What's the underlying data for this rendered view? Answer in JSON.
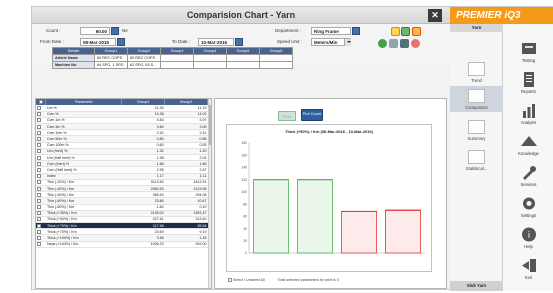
{
  "window": {
    "title": "Comparision Chart - Yarn",
    "close_label": "✕"
  },
  "brand": {
    "name": "PREMIER iQ3",
    "color": "#f39a1b"
  },
  "filters": {
    "count_label": "Count :",
    "count_value": "60.00",
    "count_unit": "Ne",
    "from_date_label": "From Date :",
    "from_date_value": "08-Mar-2016",
    "to_date_label": "To Date :",
    "to_date_value": "10-Mar-2016",
    "department_label": "Department :",
    "department_value": "Ring Frame",
    "speed_unit_label": "Speed Unit :",
    "speed_unit_value": "Meters/Min"
  },
  "summary_table": {
    "headers": [
      "Details",
      "Group1",
      "Group2",
      "Group3",
      "Group4",
      "Group5",
      "Group6"
    ],
    "rows": [
      [
        "Article Name",
        "60 REC COPS",
        "60 REC COPS",
        "",
        "",
        "",
        ""
      ],
      [
        "Machine No",
        "64 SPG, 1 SPG",
        "62 SPG, 63 S...",
        "",
        "",
        "",
        ""
      ]
    ]
  },
  "params": {
    "headers": [
      "",
      "Parameter",
      "Group1",
      "Group2"
    ],
    "rows": [
      [
        "Um %",
        "11.94",
        "11.19"
      ],
      [
        "Cvm %",
        "14.38",
        "14.02"
      ],
      [
        "Cvm 1m %",
        "4.60",
        "3.97"
      ],
      [
        "Cvm 3m %",
        "3.60",
        "3.05"
      ],
      [
        "Cvm 10m %",
        "2.52",
        "2.41"
      ],
      [
        "Cvm 50m %",
        "0.80",
        "0.85"
      ],
      [
        "Cvm 100m %",
        "0.60",
        "0.55"
      ],
      [
        "Um (Inert) %",
        "1.32",
        "1.20"
      ],
      [
        "Um (Half Inert) %",
        "1.98",
        "2.04"
      ],
      [
        "Cvm (Inert) %",
        "1.86",
        "1.66"
      ],
      [
        "Cvm (Half Inert) %",
        "2.95",
        "2.67"
      ],
      [
        "Index",
        "1.17",
        "1.11"
      ],
      [
        "Thin (-30%) / Km",
        "5113.60",
        "4412.91"
      ],
      [
        "Thin (-40%) / Km",
        "2560.53",
        "2219.96"
      ],
      [
        "Thin (-50%) / Km",
        "365.53",
        "294.08"
      ],
      [
        "Thin (-60%) / Km",
        "23.80",
        "10.67"
      ],
      [
        "Thin (-80%) / Km",
        "1.82",
        "0.10"
      ],
      [
        "Thick (+35%) / Km",
        "2135.02",
        "1951.47"
      ],
      [
        "Thick (+50%) / Km",
        "427.61",
        "313.40"
      ],
      [
        "Thick (+70%) / Km",
        "117.96",
        "65.94"
      ],
      [
        "Thick (+70%) / Km",
        "23.69",
        "9.19"
      ],
      [
        "Thick (+100%) / Km",
        "3.56",
        "1.45"
      ],
      [
        "Neps (+140%) / Km",
        "1006.23",
        "942.00"
      ]
    ],
    "selected_row": 19,
    "select_all_label": "Select / Unselect All",
    "total_selected_label": "Total selected parameters for print is 0"
  },
  "chart_buttons": {
    "print": "Print",
    "plot_count": "Plot Count"
  },
  "chart_data": {
    "type": "bar",
    "title": "Thick (+50%) / Km (08-Mar-2016 - 10-Mar-2016)",
    "xlabel": "",
    "ylabel": "",
    "ylim": [
      0,
      180
    ],
    "yticks": [
      0,
      20,
      40,
      60,
      80,
      100,
      120,
      140,
      160,
      180
    ],
    "categories": [
      "Group1",
      "Group2"
    ],
    "series": [
      {
        "values": [
          120,
          120,
          68,
          70
        ],
        "colors": [
          "#4caf50",
          "#4caf50",
          "#e53935",
          "#e53935"
        ]
      }
    ],
    "grid": false
  },
  "sidebar": {
    "header": "Yarn",
    "items": [
      {
        "label": "Trend"
      },
      {
        "label": "Comparison"
      },
      {
        "label": "Summary"
      },
      {
        "label": "Statistical..."
      }
    ],
    "footer": "Slub Yarn"
  },
  "navbar": {
    "items": [
      {
        "label": "Testing"
      },
      {
        "label": "Reports"
      },
      {
        "label": "Analysis"
      },
      {
        "label": "Knowledge"
      },
      {
        "label": "Services"
      },
      {
        "label": "Settings"
      },
      {
        "label": "Help"
      },
      {
        "label": "Exit"
      }
    ]
  }
}
